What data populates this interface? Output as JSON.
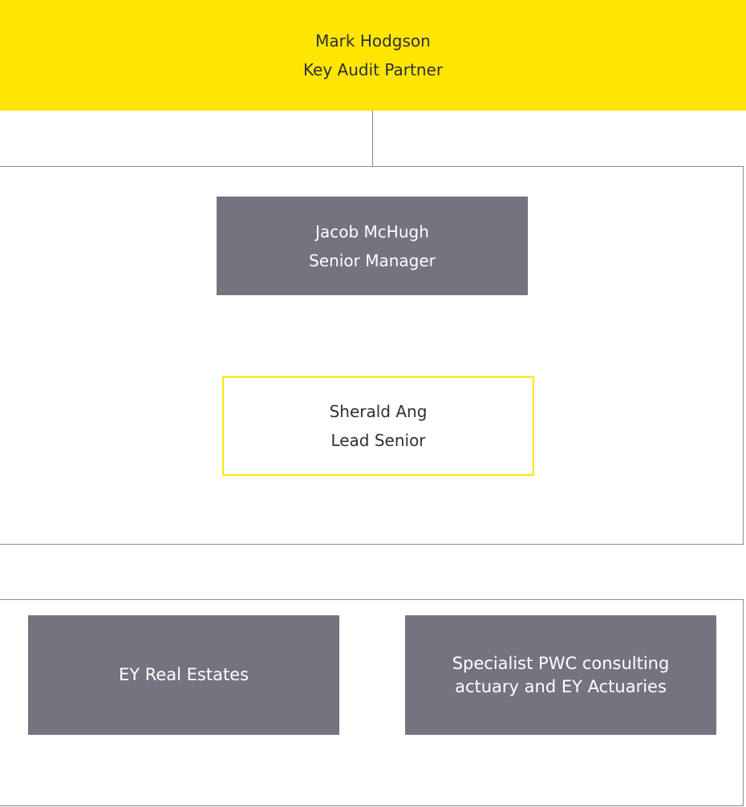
{
  "partner": {
    "name": "Mark Hodgson",
    "role": "Key Audit Partner"
  },
  "team": [
    {
      "name": "Jacob McHugh",
      "role": "Senior Manager"
    },
    {
      "name": "Sherald Ang",
      "role": "Lead Senior"
    }
  ],
  "specialists": [
    {
      "label": "EY Real Estates"
    },
    {
      "line1": "Specialist PWC consulting",
      "line2": "actuary and EY Actuaries"
    }
  ],
  "colors": {
    "brand_yellow": "#ffe600",
    "box_grey": "#747480",
    "frame_line": "#8a8a92",
    "dark_text": "#2e2e38"
  }
}
